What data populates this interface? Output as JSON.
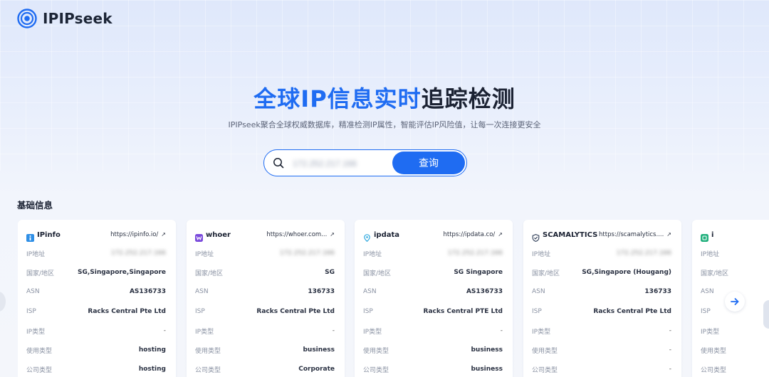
{
  "brand": {
    "name": "IPIPseek"
  },
  "hero": {
    "title_part1": "全球IP信息",
    "title_part2": "实时",
    "title_part3": "追踪检测",
    "subtitle": "IPIPseek聚合全球权威数据库，精准检测IP属性，智能评估IP风险值，让每一次连接更安全"
  },
  "search": {
    "input_value": "172.252.217.166",
    "button_label": "查询"
  },
  "section": {
    "title": "基础信息"
  },
  "colors": {
    "accent": "#1f6cf2"
  },
  "labels": {
    "ip": "IP地址",
    "country": "国家/地区",
    "asn": "ASN",
    "isp": "ISP",
    "ip_type": "IP类型",
    "usage_type": "使用类型",
    "company_type": "公司类型"
  },
  "cards": [
    {
      "name": "IPinfo",
      "icon": "ipinfo-icon",
      "url": "https://ipinfo.io/",
      "ip": "172.252.217.166",
      "country": "SG,Singapore,Singapore",
      "asn": "AS136733",
      "isp": "Racks Central Pte Ltd",
      "ip_type": "-",
      "usage_type": "hosting",
      "company_type": "hosting"
    },
    {
      "name": "whoer",
      "icon": "whoer-icon",
      "url": "https://whoer.com...",
      "ip": "172.252.217.166",
      "country": "SG",
      "asn": "136733",
      "isp": "Racks Central Pte Ltd",
      "ip_type": "-",
      "usage_type": "business",
      "company_type": "Corporate"
    },
    {
      "name": "ipdata",
      "icon": "ipdata-icon",
      "url": "https://ipdata.co/",
      "ip": "172.252.217.166",
      "country": "SG Singapore",
      "asn": "AS136733",
      "isp": "Racks Central PTE Ltd",
      "ip_type": "-",
      "usage_type": "business",
      "company_type": "business"
    },
    {
      "name": "SCAMALYTICS",
      "icon": "scamalytics-icon",
      "url": "https://scamalytics....",
      "ip": "172.252.217.166",
      "country": "SG,Singapore (Hougang)",
      "asn": "136733",
      "isp": "Racks Central Pte Ltd",
      "ip_type": "-",
      "usage_type": "-",
      "company_type": "-"
    },
    {
      "name": "i",
      "icon": "ipapi-icon",
      "url": "",
      "ip": "",
      "country": "",
      "asn": "",
      "isp": "",
      "ip_type": "",
      "usage_type": "",
      "company_type": ""
    }
  ]
}
